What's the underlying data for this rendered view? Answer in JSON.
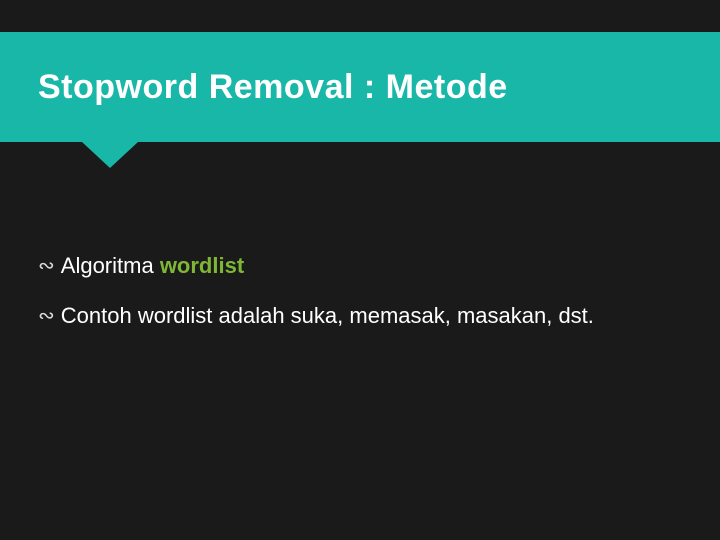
{
  "title": "Stopword Removal : Metode",
  "bullets": [
    {
      "pre": "Algoritma ",
      "hl": "wordlist",
      "post": ""
    },
    {
      "pre": "Contoh  wordlist adalah suka, memasak, masakan, dst.",
      "hl": "",
      "post": ""
    }
  ],
  "glyph": "∾"
}
